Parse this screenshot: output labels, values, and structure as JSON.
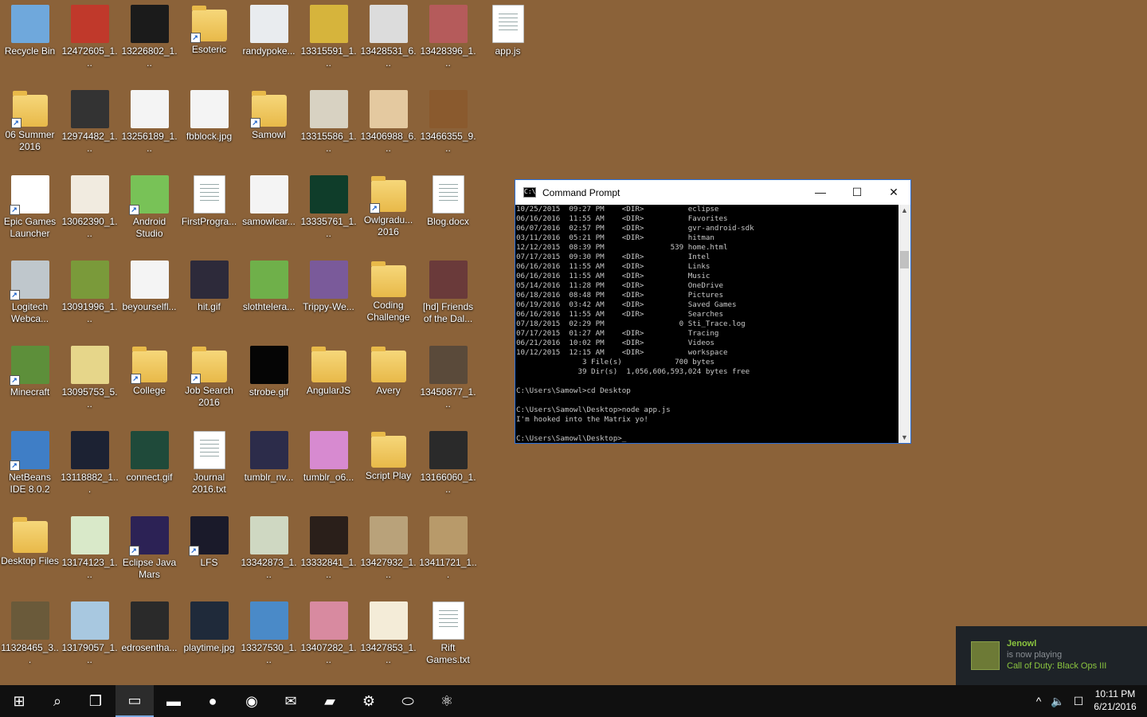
{
  "desktop": {
    "icons": [
      {
        "label": "Recycle Bin",
        "icon": "recycle-bin-icon",
        "color": "#6fa8dc",
        "shortcut": false
      },
      {
        "label": "12472605_1...",
        "icon": "image-thumbnail-icon",
        "color": "#c0392b",
        "shortcut": false
      },
      {
        "label": "13226802_1...",
        "icon": "image-thumbnail-icon",
        "color": "#1b1b1b",
        "shortcut": false
      },
      {
        "label": "Esoteric",
        "icon": "folder-icon",
        "color": "#f2cf62",
        "shortcut": true
      },
      {
        "label": "randypoke...",
        "icon": "image-thumbnail-icon",
        "color": "#e9ecef",
        "shortcut": false
      },
      {
        "label": "13315591_1...",
        "icon": "image-thumbnail-icon",
        "color": "#d6b43c",
        "shortcut": false
      },
      {
        "label": "13428531_6...",
        "icon": "image-thumbnail-icon",
        "color": "#dcdcdc",
        "shortcut": false
      },
      {
        "label": "13428396_1...",
        "icon": "image-thumbnail-icon",
        "color": "#b55b5b",
        "shortcut": false
      },
      {
        "label": "app.js",
        "icon": "script-file-icon",
        "color": "#ffffff",
        "shortcut": false
      },
      {
        "label": "06 Summer 2016",
        "icon": "folder-icon",
        "color": "#e7b53c",
        "shortcut": true
      },
      {
        "label": "12974482_1...",
        "icon": "image-thumbnail-icon",
        "color": "#333333",
        "shortcut": false
      },
      {
        "label": "13256189_1...",
        "icon": "image-thumbnail-icon",
        "color": "#f4f4f4",
        "shortcut": false
      },
      {
        "label": "fbblock.jpg",
        "icon": "image-thumbnail-icon",
        "color": "#f4f4f4",
        "shortcut": false
      },
      {
        "label": "Samowl",
        "icon": "folder-icon",
        "color": "#f2cf62",
        "shortcut": true
      },
      {
        "label": "13315586_1...",
        "icon": "image-thumbnail-icon",
        "color": "#d8d2c2",
        "shortcut": false
      },
      {
        "label": "13406988_6...",
        "icon": "image-thumbnail-icon",
        "color": "#e4c9a0",
        "shortcut": false
      },
      {
        "label": "13466355_9...",
        "icon": "image-thumbnail-icon",
        "color": "#8a5a2e",
        "shortcut": false
      },
      {
        "label": "Epic Games Launcher",
        "icon": "epic-games-icon",
        "color": "#ffffff",
        "shortcut": true
      },
      {
        "label": "13062390_1...",
        "icon": "image-thumbnail-icon",
        "color": "#f1ebe0",
        "shortcut": false
      },
      {
        "label": "Android Studio",
        "icon": "android-studio-icon",
        "color": "#78c257",
        "shortcut": true
      },
      {
        "label": "FirstProgra...",
        "icon": "python-file-icon",
        "color": "#ffffff",
        "shortcut": false
      },
      {
        "label": "samowlcar...",
        "icon": "image-thumbnail-icon",
        "color": "#f4f4f4",
        "shortcut": false
      },
      {
        "label": "13335761_1...",
        "icon": "image-thumbnail-icon",
        "color": "#0f3d2a",
        "shortcut": false
      },
      {
        "label": "Owlgradu... 2016",
        "icon": "folder-icon",
        "color": "#6b8f3a",
        "shortcut": true
      },
      {
        "label": "Blog.docx",
        "icon": "word-document-icon",
        "color": "#2b579a",
        "shortcut": false
      },
      {
        "label": "Logitech Webca...",
        "icon": "webcam-icon",
        "color": "#bfc7cc",
        "shortcut": true
      },
      {
        "label": "13091996_1...",
        "icon": "image-thumbnail-icon",
        "color": "#7a9a3a",
        "shortcut": false
      },
      {
        "label": "beyourselfl...",
        "icon": "image-thumbnail-icon",
        "color": "#f4f4f4",
        "shortcut": false
      },
      {
        "label": "hit.gif",
        "icon": "image-thumbnail-icon",
        "color": "#2d2a3a",
        "shortcut": false
      },
      {
        "label": "slothtelera...",
        "icon": "image-thumbnail-icon",
        "color": "#6fb04a",
        "shortcut": false
      },
      {
        "label": "Trippy-We...",
        "icon": "image-thumbnail-icon",
        "color": "#7a5a9a",
        "shortcut": false
      },
      {
        "label": "Coding Challenge",
        "icon": "folder-icon",
        "color": "#f2cf62",
        "shortcut": false
      },
      {
        "label": "[hd] Friends of the Dal...",
        "icon": "image-thumbnail-icon",
        "color": "#6a3a3a",
        "shortcut": false
      },
      {
        "label": "Minecraft",
        "icon": "minecraft-icon",
        "color": "#5d8f3a",
        "shortcut": true
      },
      {
        "label": "13095753_5...",
        "icon": "image-thumbnail-icon",
        "color": "#e6d68a",
        "shortcut": false
      },
      {
        "label": "College",
        "icon": "folder-icon",
        "color": "#f2cf62",
        "shortcut": true
      },
      {
        "label": "Job Search 2016",
        "icon": "folder-pdf-icon",
        "color": "#f2cf62",
        "shortcut": true
      },
      {
        "label": "strobe.gif",
        "icon": "image-thumbnail-icon",
        "color": "#050505",
        "shortcut": false
      },
      {
        "label": "AngularJS",
        "icon": "folder-icon",
        "color": "#f2cf62",
        "shortcut": false
      },
      {
        "label": "Avery",
        "icon": "folder-pdf-icon",
        "color": "#f2cf62",
        "shortcut": false
      },
      {
        "label": "13450877_1...",
        "icon": "image-thumbnail-icon",
        "color": "#5a4a3a",
        "shortcut": false
      },
      {
        "label": "NetBeans IDE 8.0.2",
        "icon": "netbeans-icon",
        "color": "#3f7ec6",
        "shortcut": true
      },
      {
        "label": "13118882_1...",
        "icon": "image-thumbnail-icon",
        "color": "#1c2233",
        "shortcut": false
      },
      {
        "label": "connect.gif",
        "icon": "image-thumbnail-icon",
        "color": "#1f4a3a",
        "shortcut": false
      },
      {
        "label": "Journal 2016.txt",
        "icon": "text-file-icon",
        "color": "#ffffff",
        "shortcut": false
      },
      {
        "label": "tumblr_nv...",
        "icon": "image-thumbnail-icon",
        "color": "#2c2c4a",
        "shortcut": false
      },
      {
        "label": "tumblr_o6...",
        "icon": "image-thumbnail-icon",
        "color": "#d78ad0",
        "shortcut": false
      },
      {
        "label": "Script Play",
        "icon": "folder-pdf-icon",
        "color": "#f2cf62",
        "shortcut": false
      },
      {
        "label": "13166060_1...",
        "icon": "image-thumbnail-icon",
        "color": "#2a2a2a",
        "shortcut": false
      },
      {
        "label": "Desktop Files",
        "icon": "folder-icon",
        "color": "#f2cf62",
        "shortcut": false
      },
      {
        "label": "13174123_1...",
        "icon": "image-thumbnail-icon",
        "color": "#d9e9c9",
        "shortcut": false
      },
      {
        "label": "Eclipse Java Mars",
        "icon": "eclipse-icon",
        "color": "#2c2255",
        "shortcut": true
      },
      {
        "label": "LFS",
        "icon": "lfs-icon",
        "color": "#1a1a2a",
        "shortcut": true
      },
      {
        "label": "13342873_1...",
        "icon": "image-thumbnail-icon",
        "color": "#cfd8c2",
        "shortcut": false
      },
      {
        "label": "13332841_1...",
        "icon": "image-thumbnail-icon",
        "color": "#2a1f1a",
        "shortcut": false
      },
      {
        "label": "13427932_1...",
        "icon": "image-thumbnail-icon",
        "color": "#b9a27a",
        "shortcut": false
      },
      {
        "label": "13411721_1...",
        "icon": "image-thumbnail-icon",
        "color": "#b89a6a",
        "shortcut": false
      },
      {
        "label": "11328465_3...",
        "icon": "image-thumbnail-icon",
        "color": "#6a5a3a",
        "shortcut": false
      },
      {
        "label": "13179057_1...",
        "icon": "image-thumbnail-icon",
        "color": "#a8c8e0",
        "shortcut": false
      },
      {
        "label": "edrosentha...",
        "icon": "image-thumbnail-icon",
        "color": "#2a2a2a",
        "shortcut": false
      },
      {
        "label": "playtime.jpg",
        "icon": "image-thumbnail-icon",
        "color": "#1f2a3a",
        "shortcut": false
      },
      {
        "label": "13327530_1...",
        "icon": "image-thumbnail-icon",
        "color": "#4a8ac8",
        "shortcut": false
      },
      {
        "label": "13407282_1...",
        "icon": "image-thumbnail-icon",
        "color": "#d88aa0",
        "shortcut": false
      },
      {
        "label": "13427853_1...",
        "icon": "image-thumbnail-icon",
        "color": "#f4ecd8",
        "shortcut": false
      },
      {
        "label": "Rift Games.txt",
        "icon": "text-file-icon",
        "color": "#ffffff",
        "shortcut": false
      }
    ]
  },
  "cmd": {
    "title": "Command Prompt",
    "lines": [
      "10/25/2015  09:27 PM    <DIR>          eclipse",
      "06/16/2016  11:55 AM    <DIR>          Favorites",
      "06/07/2016  02:57 PM    <DIR>          gvr-android-sdk",
      "03/11/2016  05:21 PM    <DIR>          hitman",
      "12/12/2015  08:39 PM               539 home.html",
      "07/17/2015  09:30 PM    <DIR>          Intel",
      "06/16/2016  11:55 AM    <DIR>          Links",
      "06/16/2016  11:55 AM    <DIR>          Music",
      "05/14/2016  11:28 PM    <DIR>          OneDrive",
      "06/18/2016  08:48 PM    <DIR>          Pictures",
      "06/19/2016  03:42 AM    <DIR>          Saved Games",
      "06/16/2016  11:55 AM    <DIR>          Searches",
      "07/18/2015  02:29 PM                 0 Sti_Trace.log",
      "07/17/2015  01:27 AM    <DIR>          Tracing",
      "06/21/2016  10:02 PM    <DIR>          Videos",
      "10/12/2015  12:15 AM    <DIR>          workspace",
      "               3 File(s)            700 bytes",
      "              39 Dir(s)  1,056,606,593,024 bytes free",
      "",
      "C:\\Users\\Samowl>cd Desktop",
      "",
      "C:\\Users\\Samowl\\Desktop>node app.js",
      "I'm hooked into the Matrix yo!",
      "",
      "C:\\Users\\Samowl\\Desktop>_"
    ]
  },
  "notification": {
    "user": "Jenowl",
    "status": "is now playing",
    "game": "Call of Duty: Black Ops III"
  },
  "taskbar": {
    "apps": [
      {
        "name": "start-button",
        "glyph": "⊞"
      },
      {
        "name": "search-icon",
        "glyph": "⌕"
      },
      {
        "name": "task-view-icon",
        "glyph": "❐"
      },
      {
        "name": "command-prompt-taskbar-icon",
        "glyph": "▭"
      },
      {
        "name": "file-explorer-icon",
        "glyph": "▬"
      },
      {
        "name": "firefox-icon",
        "glyph": "●"
      },
      {
        "name": "chrome-icon",
        "glyph": "◉"
      },
      {
        "name": "outlook-icon",
        "glyph": "✉"
      },
      {
        "name": "folder-taskbar-icon",
        "glyph": "▰"
      },
      {
        "name": "steam-icon",
        "glyph": "⚙"
      },
      {
        "name": "oculus-icon",
        "glyph": "⬭"
      },
      {
        "name": "atom-icon",
        "glyph": "⚛"
      }
    ],
    "tray": {
      "chevron": "^",
      "volume": "🔈",
      "action_center": "☐"
    },
    "time": "10:11 PM",
    "date": "6/21/2016"
  }
}
